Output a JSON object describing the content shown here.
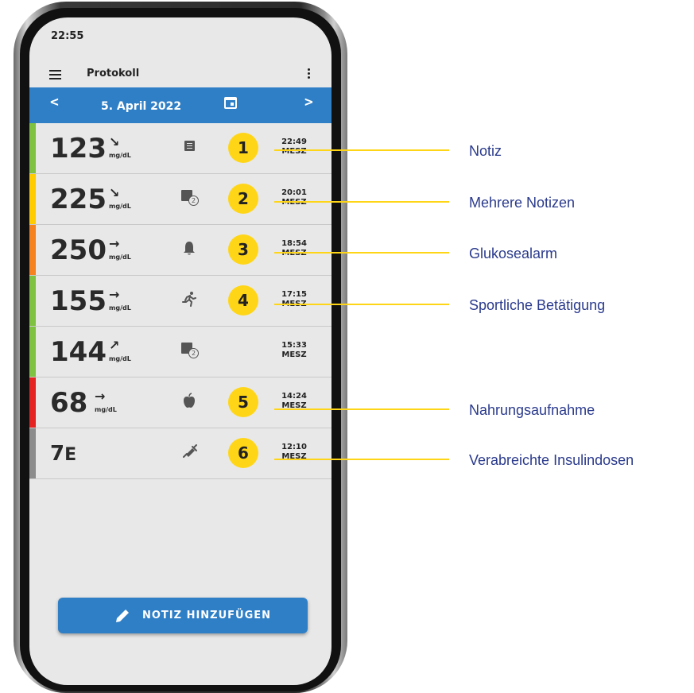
{
  "status_time": "22:55",
  "app_bar": {
    "title": "Protokoll"
  },
  "date_bar": {
    "date": "5. April 2022",
    "prev_icon": "chevron-left-icon",
    "next_icon": "chevron-right-icon",
    "calendar_icon": "calendar-icon"
  },
  "rows": [
    {
      "value": "123",
      "trend": "↘",
      "unit": "mg/dL",
      "color": "#7fc241",
      "event_icon": "note-icon",
      "badge": "1",
      "time": "22:49",
      "tz": "MESZ"
    },
    {
      "value": "225",
      "trend": "↘",
      "unit": "mg/dL",
      "color": "#ffcc00",
      "event_icon": "multiple-notes-icon",
      "event_count": "2",
      "badge": "2",
      "time": "20:01",
      "tz": "MESZ"
    },
    {
      "value": "250",
      "trend": "→",
      "unit": "mg/dL",
      "color": "#f5821f",
      "event_icon": "bell-icon",
      "badge": "3",
      "time": "18:54",
      "tz": "MESZ"
    },
    {
      "value": "155",
      "trend": "→",
      "unit": "mg/dL",
      "color": "#7fc241",
      "event_icon": "running-icon",
      "badge": "4",
      "time": "17:15",
      "tz": "MESZ"
    },
    {
      "value": "144",
      "trend": "↗",
      "unit": "mg/dL",
      "color": "#7fc241",
      "event_icon": "multiple-notes-icon",
      "event_count": "2",
      "badge": "",
      "time": "15:33",
      "tz": "MESZ"
    },
    {
      "value": "68",
      "trend": "→",
      "unit": "mg/dL",
      "color": "#e52421",
      "event_icon": "apple-icon",
      "badge": "5",
      "time": "14:24",
      "tz": "MESZ"
    },
    {
      "value": "7",
      "trend": "",
      "unit": "E",
      "color": "#8c8c8c",
      "event_icon": "syringe-icon",
      "badge": "6",
      "time": "12:10",
      "tz": "MESZ"
    }
  ],
  "fab": {
    "label": "NOTIZ HINZUFÜGEN",
    "icon": "pencil-icon"
  },
  "callouts": [
    "Notiz",
    "Mehrere Notizen",
    "Glukosealarm",
    "Sportliche Betätigung",
    "Nahrungsaufnahme",
    "Verabreichte Insulindosen"
  ]
}
